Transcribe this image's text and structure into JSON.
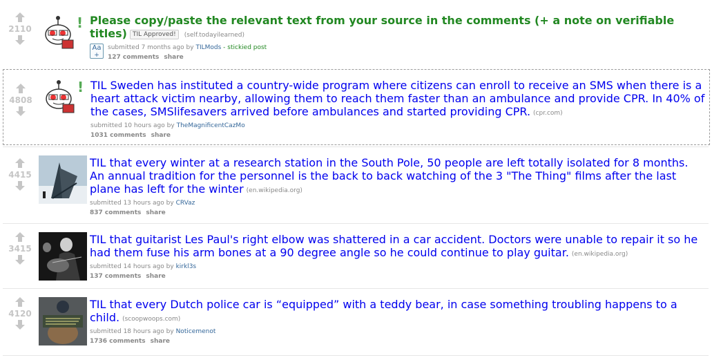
{
  "posts": [
    {
      "score": "2110",
      "title": "Please copy/paste the relevant text from your source in the comments (+ a note on verifiable titles)",
      "flair": "TIL Approved!",
      "domain": "(self.todayilearned)",
      "submitted_prefix": "submitted",
      "time": "7 months ago",
      "by": "by",
      "author": "TILMods",
      "stickied": "- stickied post",
      "comments": "127 comments",
      "share": "share",
      "expand_icon": "Aa",
      "expand_plus": "+",
      "thumb_icon": "reddit-alien-icon"
    },
    {
      "score": "4808",
      "title": "TIL Sweden has instituted a country-wide program where citizens can enroll to receive an SMS when there is a heart attack victim nearby, allowing them to reach them faster than an ambulance and provide CPR. In 40% of the cases, SMSlifesavers arrived before ambulances and started providing CPR.",
      "domain": "(cpr.com)",
      "submitted_prefix": "submitted",
      "time": "10 hours ago",
      "by": "by",
      "author": "TheMagnificentCazMo",
      "comments": "1031 comments",
      "share": "share",
      "thumb_icon": "reddit-alien-icon"
    },
    {
      "score": "4415",
      "title": "TIL that every winter at a research station in the South Pole, 50 people are left totally isolated for 8 months. An annual tradition for the personnel is the back to back watching of the 3 \"The Thing\" films after the last plane has left for the winter",
      "domain": "(en.wikipedia.org)",
      "submitted_prefix": "submitted",
      "time": "13 hours ago",
      "by": "by",
      "author": "CRVaz",
      "comments": "837 comments",
      "share": "share"
    },
    {
      "score": "3415",
      "title": "TIL that guitarist Les Paul's right elbow was shattered in a car accident. Doctors were unable to repair it so he had them fuse his arm bones at a 90 degree angle so he could continue to play guitar.",
      "domain": "(en.wikipedia.org)",
      "submitted_prefix": "submitted",
      "time": "14 hours ago",
      "by": "by",
      "author": "kirkl3s",
      "comments": "137 comments",
      "share": "share"
    },
    {
      "score": "4120",
      "title": "TIL that every Dutch police car is “equipped” with a teddy bear, in case something troubling happens to a child.",
      "domain": "(scoopwoops.com)",
      "submitted_prefix": "submitted",
      "time": "18 hours ago",
      "by": "by",
      "author": "Noticemenot",
      "comments": "1736 comments",
      "share": "share"
    }
  ],
  "colors": {
    "link": "#0000ee",
    "sticky": "#228822",
    "meta": "#888888",
    "author": "#336699",
    "arrow": "#c6c6c6"
  }
}
